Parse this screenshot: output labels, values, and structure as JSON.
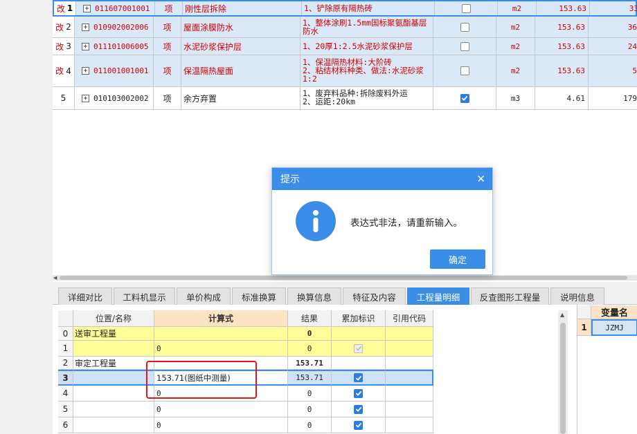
{
  "items_table": {
    "rows": [
      {
        "index": "1",
        "flag": "改",
        "code": "011607001001",
        "unit_label": "项",
        "name": "刚性层拆除",
        "desc": [
          "1、铲除原有隔热砖"
        ],
        "checked": false,
        "measure": "m2",
        "qty": "153.63",
        "extra": "33"
      },
      {
        "index": "2",
        "flag": "改",
        "code": "010902002006",
        "unit_label": "项",
        "name": "屋面涂膜防水",
        "desc": [
          "1、整体涂刷1.5mm国标聚氨酯基层",
          "防水"
        ],
        "checked": false,
        "measure": "m2",
        "qty": "153.63",
        "extra": "36"
      },
      {
        "index": "3",
        "flag": "改",
        "code": "011101006005",
        "unit_label": "项",
        "name": "水泥砂浆保护层",
        "desc": [
          "1、20厚1:2.5水泥砂浆保护层"
        ],
        "checked": false,
        "measure": "m2",
        "qty": "153.63",
        "extra": "24"
      },
      {
        "index": "4",
        "flag": "改",
        "code": "011001001001",
        "unit_label": "项",
        "name": "保温隔热屋面",
        "desc": [
          "1、保温隔热材料:大阶砖",
          "2、粘结材料种类、做法:水泥砂浆",
          "1:2"
        ],
        "checked": false,
        "measure": "m2",
        "qty": "153.63",
        "extra": "5"
      },
      {
        "index": "5",
        "flag": "",
        "code": "010103002002",
        "unit_label": "项",
        "name": "余方弃置",
        "desc": [
          "1、废弃料品种:拆除废料外运",
          "2、运距:20km"
        ],
        "checked": true,
        "measure": "m3",
        "qty": "4.61",
        "extra": "179"
      }
    ]
  },
  "tabs": [
    {
      "label": "详细对比"
    },
    {
      "label": "工料机显示"
    },
    {
      "label": "单价构成"
    },
    {
      "label": "标准换算"
    },
    {
      "label": "换算信息"
    },
    {
      "label": "特征及内容"
    },
    {
      "label": "工程量明细"
    },
    {
      "label": "反查图形工程量"
    },
    {
      "label": "说明信息"
    }
  ],
  "detail_grid": {
    "headers": {
      "pos": "位置/名称",
      "expr": "计算式",
      "result": "结果",
      "accum": "累加标识",
      "ref": "引用代码"
    },
    "rows": [
      {
        "index": "0",
        "pos": "送审工程量",
        "expr": "",
        "result": "0",
        "accum": "none",
        "ref": ""
      },
      {
        "index": "1",
        "pos": "",
        "expr": "0",
        "result": "0",
        "accum": "disabled",
        "ref": ""
      },
      {
        "index": "2",
        "pos": "审定工程量",
        "expr": "",
        "result": "153.71",
        "accum": "none",
        "ref": ""
      },
      {
        "index": "3",
        "pos": "",
        "expr": "153.71(图纸中测量)",
        "result": "153.71",
        "accum": "checked",
        "ref": ""
      },
      {
        "index": "4",
        "pos": "",
        "expr": "0",
        "result": "0",
        "accum": "checked",
        "ref": ""
      },
      {
        "index": "5",
        "pos": "",
        "expr": "0",
        "result": "0",
        "accum": "checked",
        "ref": ""
      },
      {
        "index": "6",
        "pos": "",
        "expr": "0",
        "result": "0",
        "accum": "checked",
        "ref": ""
      }
    ]
  },
  "variable_panel": {
    "header": "变量名",
    "rows": [
      {
        "index": "1",
        "name": "JZMJ"
      }
    ]
  },
  "dialog": {
    "title": "提示",
    "close": "✕",
    "message": "表达式非法，请重新输入。",
    "ok_label": "确定"
  },
  "colors": {
    "accent": "#3b8ee8",
    "flag_red": "#d10000",
    "yellow_row": "#ffff99",
    "selected_row": "#cfe3f8",
    "highlight_box": "#ee1111"
  }
}
